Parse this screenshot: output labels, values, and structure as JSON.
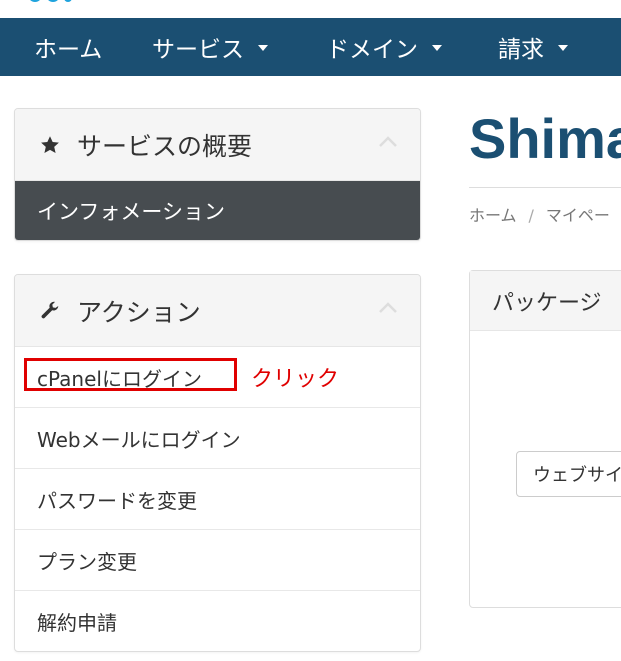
{
  "nav": {
    "home": "ホーム",
    "services": "サービス",
    "domains": "ドメイン",
    "billing": "請求"
  },
  "sidebar": {
    "overview": {
      "title": "サービスの概要",
      "icon": "star-icon",
      "active_item": "インフォメーション"
    },
    "actions": {
      "title": "アクション",
      "icon": "wrench-icon",
      "items": [
        {
          "label": "cPanelにログイン"
        },
        {
          "label": "Webメールにログイン"
        },
        {
          "label": "パスワードを変更"
        },
        {
          "label": "プラン変更"
        },
        {
          "label": "解約申請"
        }
      ]
    }
  },
  "annotation": {
    "text": "クリック",
    "color": "#e00000"
  },
  "main": {
    "title": "Shima",
    "breadcrumb": [
      "ホーム",
      "マイペー"
    ],
    "breadcrumb_sep": "/",
    "package_panel": {
      "title": "パッケージ",
      "button_label": "ウェブサイ"
    }
  },
  "colors": {
    "navbar": "#1b4f72",
    "active_item": "#474c50",
    "title": "#1b4f72"
  }
}
